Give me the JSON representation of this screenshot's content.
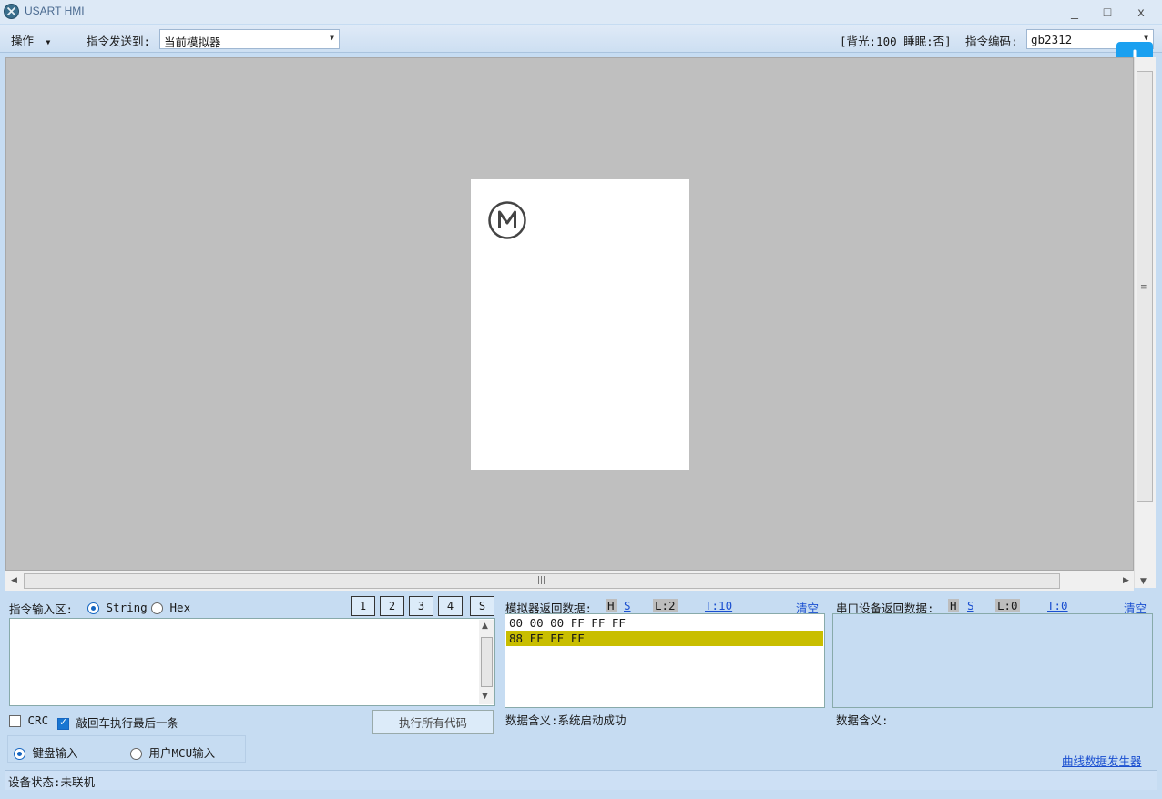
{
  "window": {
    "title": "USART HMI",
    "minimize": "_",
    "maximize": "□",
    "close": "x"
  },
  "toolbar": {
    "operate_label": "操作",
    "send_to_label": "指令发送到:",
    "send_to_value": "当前模拟器",
    "status_text": "[背光:100  睡眠:否]",
    "encoding_label": "指令编码:",
    "encoding_value": "gb2312"
  },
  "command_input": {
    "label": "指令输入区:",
    "mode_string": "String",
    "mode_hex": "Hex",
    "selected_mode": "String",
    "slot_buttons": [
      "1",
      "2",
      "3",
      "4",
      "S"
    ],
    "text": "",
    "crc_label": "CRC",
    "crc_checked": false,
    "enter_exec_label": "敲回车执行最后一条",
    "enter_exec_checked": true,
    "run_all_button": "执行所有代码",
    "keyboard_input": "键盘输入",
    "mcu_input": "用户MCU输入",
    "selected_input": "键盘输入"
  },
  "sim_return": {
    "label": "模拟器返回数据:",
    "h": "H",
    "s": "S",
    "l": "L:2",
    "t": "T:10",
    "clear": "清空",
    "lines": [
      "00 00 00 FF FF FF",
      "88 FF FF FF"
    ],
    "highlight_color": "#c9be00",
    "meaning": "数据含义:系统启动成功"
  },
  "serial_return": {
    "label": "串口设备返回数据:",
    "h": "H",
    "s": "S",
    "l": "L:0",
    "t": "T:0",
    "clear": "清空",
    "meaning": "数据含义:"
  },
  "curve_link": "曲线数据发生器",
  "status_bar": "设备状态:未联机",
  "colors": {
    "background": "#c6dcf2",
    "canvas": "#bfbfbf",
    "accent": "#1aa0f0"
  }
}
